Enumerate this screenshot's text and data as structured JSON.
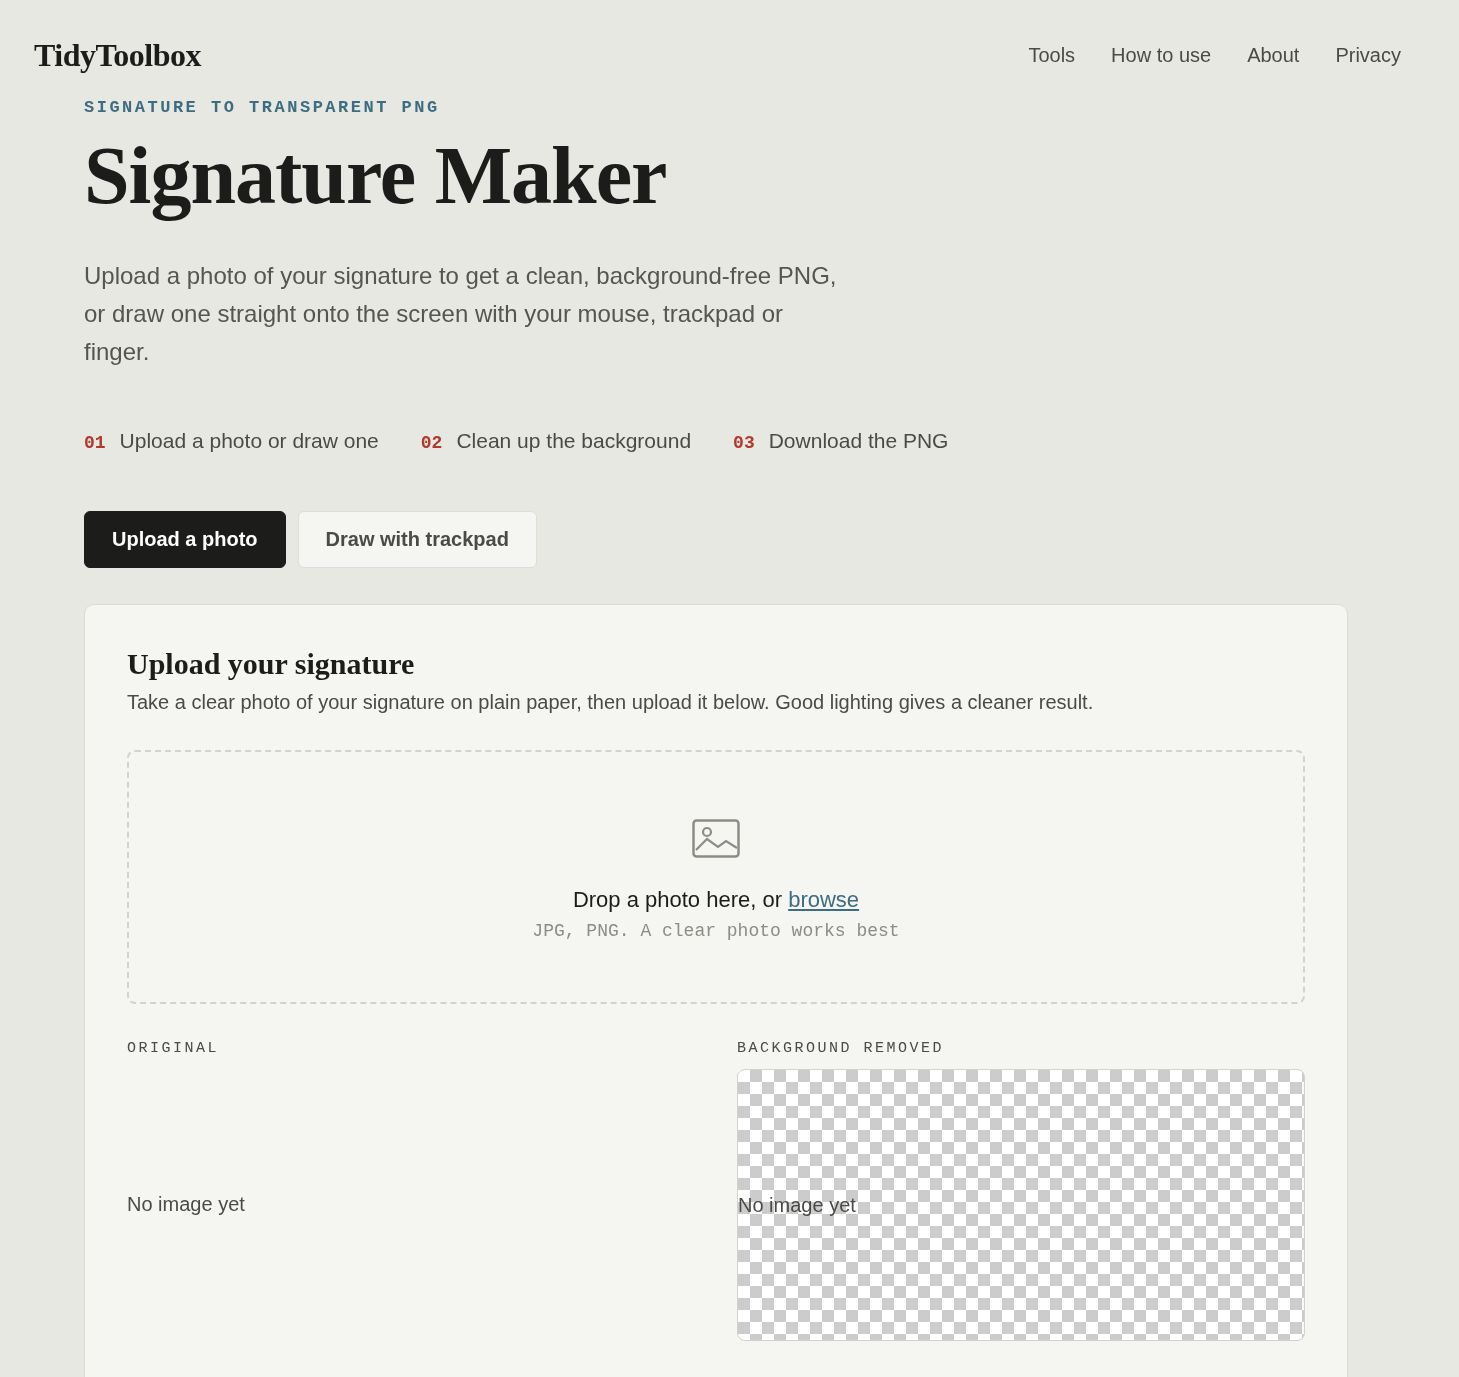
{
  "brand": "TidyToolbox",
  "nav": [
    "Tools",
    "How to use",
    "About",
    "Privacy"
  ],
  "eyebrow": "SIGNATURE TO TRANSPARENT PNG",
  "title": "Signature Maker",
  "intro": "Upload a photo of your signature to get a clean, background-free PNG, or draw one straight onto the screen with your mouse, trackpad or finger.",
  "steps": [
    {
      "number": "01",
      "label": "Upload a photo or draw one"
    },
    {
      "number": "02",
      "label": "Clean up the background"
    },
    {
      "number": "03",
      "label": "Download the PNG"
    }
  ],
  "modes": [
    {
      "label": "Upload a photo",
      "selected": true
    },
    {
      "label": "Draw with trackpad",
      "selected": false
    }
  ],
  "panel": {
    "title": "Upload your signature",
    "description": "Take a clear photo of your signature on plain paper, then upload it below. Good lighting gives a cleaner result.",
    "dropzone": {
      "prompt": "Drop a photo here, or ",
      "link": "browse",
      "hint": "JPG, PNG. A clear photo works best"
    },
    "previews": [
      {
        "label": "ORIGINAL",
        "kind": "plain",
        "empty": "No image yet"
      },
      {
        "label": "BACKGROUND REMOVED",
        "kind": "transparent",
        "empty": "No image yet"
      }
    ]
  }
}
